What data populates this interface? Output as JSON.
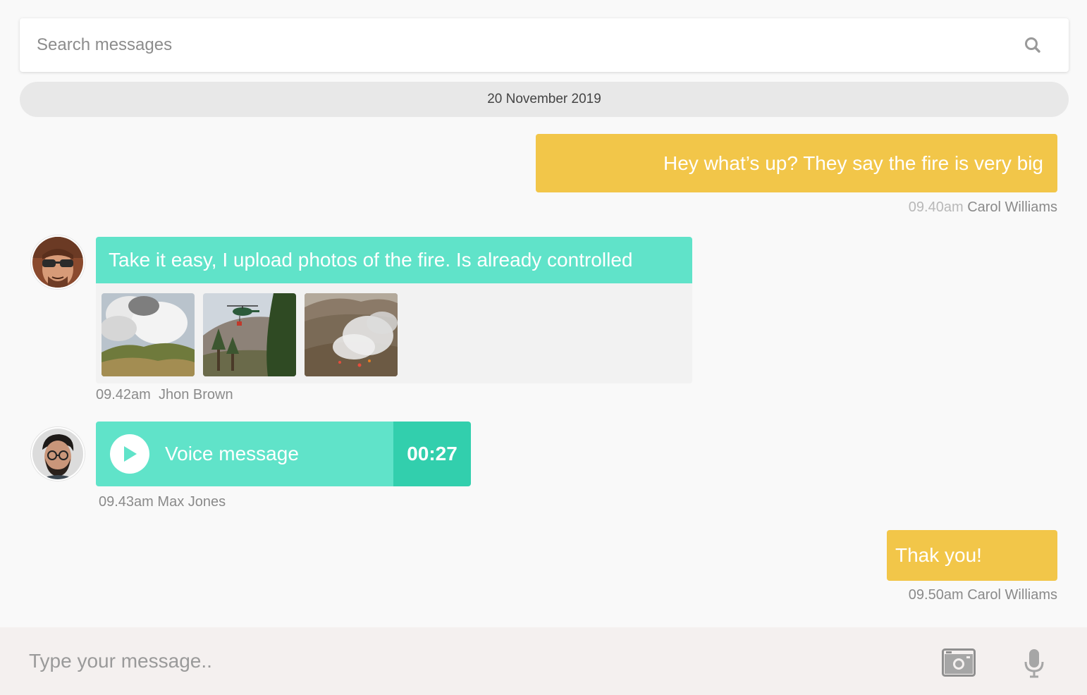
{
  "search": {
    "placeholder": "Search messages",
    "icon": "search-icon"
  },
  "date_divider": "20 November 2019",
  "colors": {
    "outgoing_bubble": "#f2c649",
    "incoming_bubble": "#60e3c9",
    "voice_duration_bg": "#32cfad",
    "background": "#f9f9f9",
    "composer_bg": "#f4f0ef"
  },
  "messages": [
    {
      "type": "text",
      "direction": "outgoing",
      "text": "Hey what’s up? They say the fire is very big",
      "time": "09.40am",
      "sender": "Carol Williams"
    },
    {
      "type": "text_with_photos",
      "direction": "incoming",
      "text": "Take it easy, I upload photos of the fire. Is already controlled",
      "photos": [
        "smoke-over-hills",
        "helicopter-water-drop",
        "brush-fire-smoke"
      ],
      "time": "09.42am",
      "sender": "Jhon Brown"
    },
    {
      "type": "voice",
      "direction": "incoming",
      "label": "Voice message",
      "duration": "00:27",
      "time": "09.43am",
      "sender": "Max Jones"
    },
    {
      "type": "text",
      "direction": "outgoing",
      "text": "Thak you!",
      "time": "09.50am",
      "sender": "Carol Williams"
    }
  ],
  "composer": {
    "placeholder": "Type your message..",
    "icons": [
      "camera-icon",
      "microphone-icon"
    ]
  }
}
